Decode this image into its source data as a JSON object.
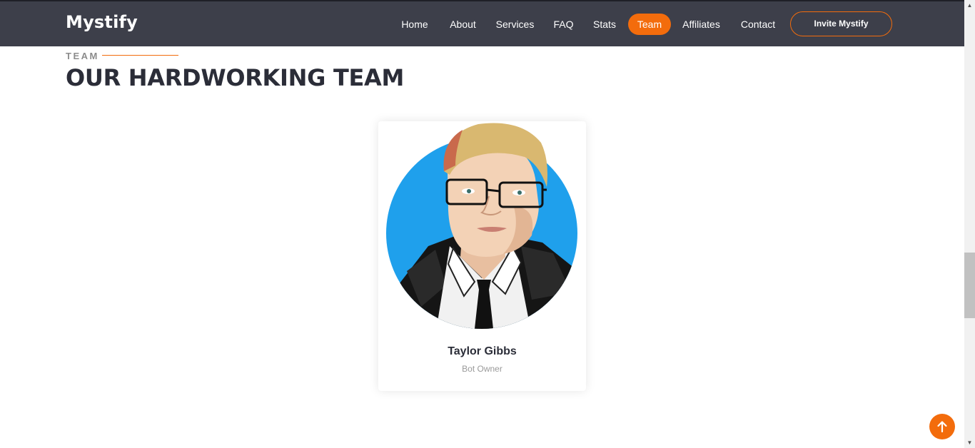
{
  "header": {
    "brand": "Mystify",
    "nav": [
      {
        "label": "Home",
        "active": false
      },
      {
        "label": "About",
        "active": false
      },
      {
        "label": "Services",
        "active": false
      },
      {
        "label": "FAQ",
        "active": false
      },
      {
        "label": "Stats",
        "active": false
      },
      {
        "label": "Team",
        "active": true
      },
      {
        "label": "Affiliates",
        "active": false
      },
      {
        "label": "Contact",
        "active": false
      }
    ],
    "cta_label": "Invite Mystify"
  },
  "section": {
    "eyebrow": "TEAM",
    "title": "OUR HARDWORKING TEAM"
  },
  "team": [
    {
      "name": "Taylor Gibbs",
      "role": "Bot Owner",
      "avatar_icon": "cartoon-portrait-avatar"
    }
  ],
  "back_to_top_icon": "arrow-up-icon",
  "colors": {
    "accent": "#f36c0c",
    "header_bg": "#3d3f4a",
    "title": "#2b2d38",
    "avatar_bg": "#1fa0ec"
  }
}
